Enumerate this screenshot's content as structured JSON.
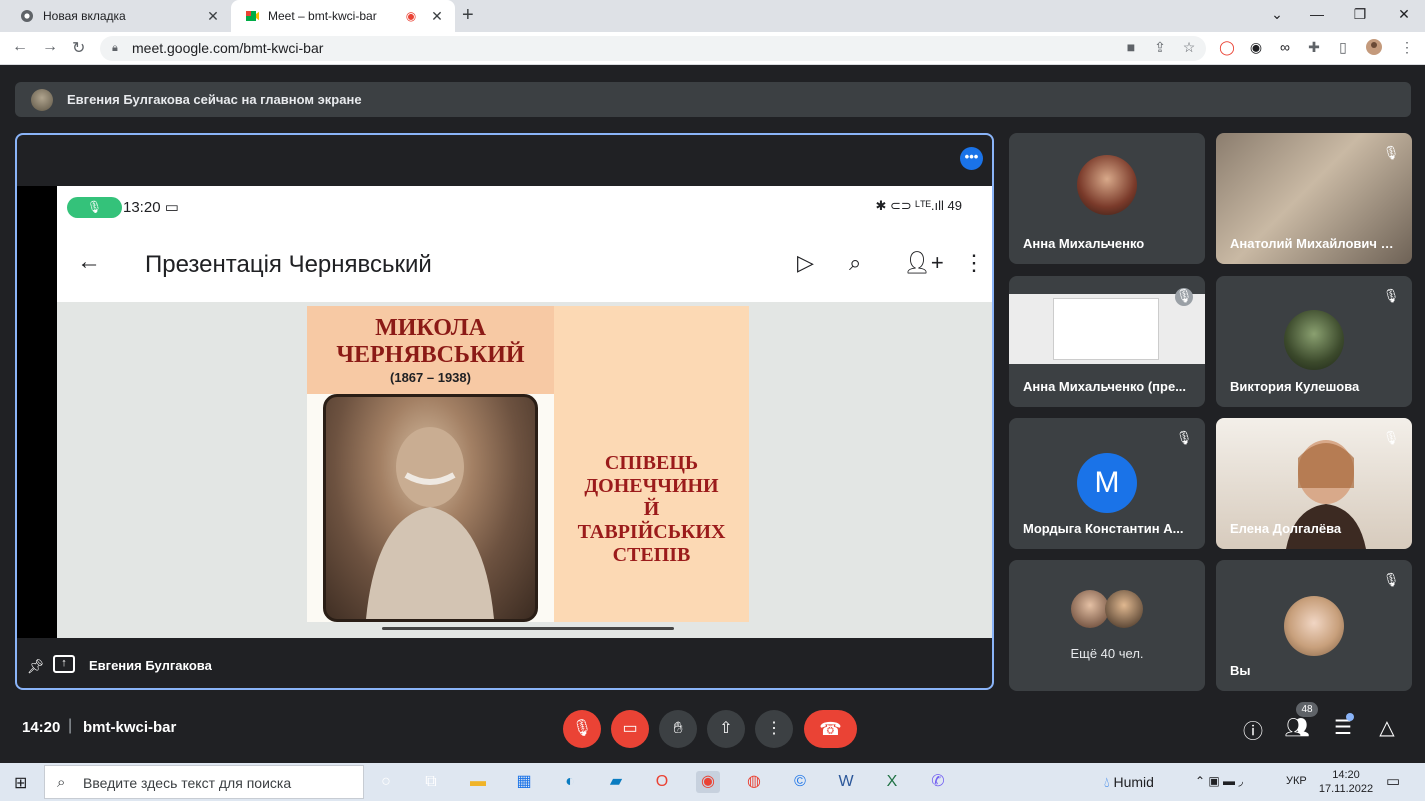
{
  "browser": {
    "tabs": [
      {
        "title": "Новая вкладка",
        "icon": "chrome-icon",
        "active": false
      },
      {
        "title": "Meet – bmt-kwci-bar",
        "icon": "meet-icon",
        "active": true
      }
    ],
    "url": "meet.google.com/bmt-kwci-bar"
  },
  "banner": {
    "text": "Евгения Булгакова сейчас на главном экране"
  },
  "presentation": {
    "phone_time": "13:20",
    "phone_status": "✱ ⊂⊃ ᴸᵀᴱ.ıll 49",
    "app_title": "Презентація Чернявський",
    "slide_name_line1": "МИКОЛА",
    "slide_name_line2": "ЧЕРНЯВСЬКИЙ",
    "slide_years": "(1867 – 1938)",
    "slide_right_text": [
      "СПІВЕЦЬ",
      "ДОНЕЧЧИНИ",
      "Й",
      "ТАВРІЙСЬКИХ",
      "СТЕПІВ"
    ],
    "presenter": "Евгения Булгакова"
  },
  "participants": [
    {
      "name": "Анна Михальченко",
      "muted": false,
      "avatar": "photo"
    },
    {
      "name": "Анатолий Михайлович Б...",
      "muted": true,
      "avatar": "video"
    },
    {
      "name": "Анна Михальченко (пре...",
      "muted": true,
      "avatar": "screen"
    },
    {
      "name": "Виктория Кулешова",
      "muted": true,
      "avatar": "photo"
    },
    {
      "name": "Мордыга Константин А...",
      "muted": true,
      "avatar_letter": "М"
    },
    {
      "name": "Елена Долгалёва",
      "muted": true,
      "avatar": "video"
    },
    {
      "name": "Ещё 40 чел.",
      "muted": false,
      "avatar": "group"
    },
    {
      "name": "Вы",
      "muted": true,
      "avatar": "photo"
    }
  ],
  "bottom": {
    "time": "14:20",
    "separator": "|",
    "meeting_code": "bmt-kwci-bar",
    "participant_count": "48"
  },
  "taskbar": {
    "search_placeholder": "Введите здесь текст для поиска",
    "weather": "Humid",
    "lang": "УКР",
    "time": "14:20",
    "date": "17.11.2022"
  },
  "colors": {
    "accent": "#8ab4f8",
    "hangup": "#ea4335",
    "meet_blue": "#1a73e8"
  }
}
